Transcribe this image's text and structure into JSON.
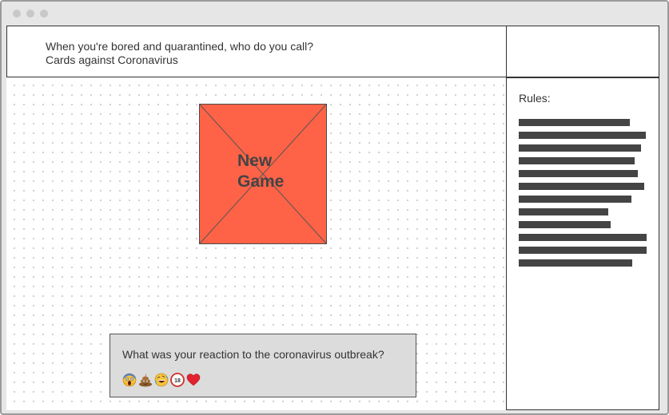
{
  "header": {
    "line1": "When you're bored and quarantined, who do you call?",
    "line2": "Cards against Coronavirus"
  },
  "main": {
    "new_game_label_line1": "New",
    "new_game_label_line2": "Game"
  },
  "sidebar": {
    "rules_title": "Rules:",
    "rule_line_count": 12
  },
  "poll": {
    "question": "What was your reaction to the coronavirus outbreak?",
    "reactions": [
      "screaming-face-emoji",
      "pile-of-poo-emoji",
      "rolling-laughing-emoji",
      "no-under-18-emoji",
      "red-heart-emoji"
    ]
  },
  "colors": {
    "new_game_fill": "#ff6347",
    "window_chrome": "#e6e6e6",
    "placeholder_bar": "#444444",
    "poll_background": "#dcdcdc"
  }
}
